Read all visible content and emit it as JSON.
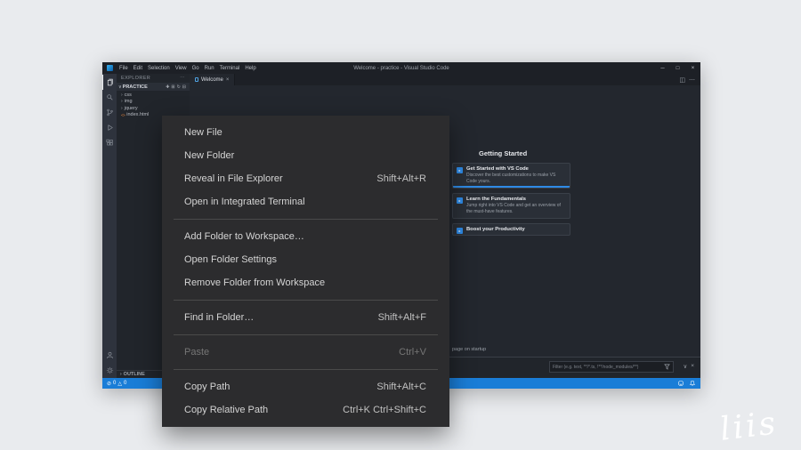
{
  "window": {
    "title": "Welcome - practice - Visual Studio Code",
    "menubar": [
      "File",
      "Edit",
      "Selection",
      "View",
      "Go",
      "Run",
      "Terminal",
      "Help"
    ]
  },
  "icons": {
    "close": "×",
    "more": "⋯",
    "chevron_down": "∨",
    "chevron_right": "›",
    "minimize": "─",
    "maximize": "□",
    "split_editor": "◫",
    "new_file": "✚",
    "new_folder": "⊞",
    "refresh": "↻",
    "collapse_all": "⊟",
    "html": "<>",
    "error": "⊘",
    "warning": "△"
  },
  "sidebar": {
    "header": "EXPLORER",
    "section": "PRACTICE",
    "items": [
      {
        "label": "css"
      },
      {
        "label": "img"
      },
      {
        "label": "jquery"
      },
      {
        "label": "index.html"
      }
    ],
    "outline": "OUTLINE"
  },
  "editor": {
    "tab": "Welcome",
    "heading": "Getting Started",
    "cards": [
      {
        "title": "Get Started with VS Code",
        "desc": "Discover the best customizations to make VS Code yours."
      },
      {
        "title": "Learn the Fundamentals",
        "desc": "Jump right into VS Code and get an overview of the must-have features."
      },
      {
        "title": "Boost your Productivity",
        "desc": ""
      }
    ],
    "startup_text": "page on startup"
  },
  "panel": {
    "filter_placeholder": "Filter (e.g. text, **/*.ts, !**/node_modules/**)"
  },
  "status_bar": {
    "errors": "0",
    "warnings": "0"
  },
  "context_menu": {
    "groups": [
      {
        "items": [
          {
            "label": "New File"
          },
          {
            "label": "New Folder"
          },
          {
            "label": "Reveal in File Explorer",
            "shortcut": "Shift+Alt+R"
          },
          {
            "label": "Open in Integrated Terminal"
          }
        ]
      },
      {
        "items": [
          {
            "label": "Add Folder to Workspace…"
          },
          {
            "label": "Open Folder Settings"
          },
          {
            "label": "Remove Folder from Workspace"
          }
        ]
      },
      {
        "items": [
          {
            "label": "Find in Folder…",
            "shortcut": "Shift+Alt+F"
          }
        ]
      },
      {
        "items": [
          {
            "label": "Paste",
            "shortcut": "Ctrl+V",
            "disabled": true
          }
        ]
      },
      {
        "items": [
          {
            "label": "Copy Path",
            "shortcut": "Shift+Alt+C"
          },
          {
            "label": "Copy Relative Path",
            "shortcut": "Ctrl+K Ctrl+Shift+C"
          }
        ]
      }
    ]
  },
  "colors": {
    "status_bar": "#1a7dd7",
    "accent_blue": "#2e8ae6",
    "menu_bg": "#2c2c2e"
  },
  "watermark": "liis"
}
